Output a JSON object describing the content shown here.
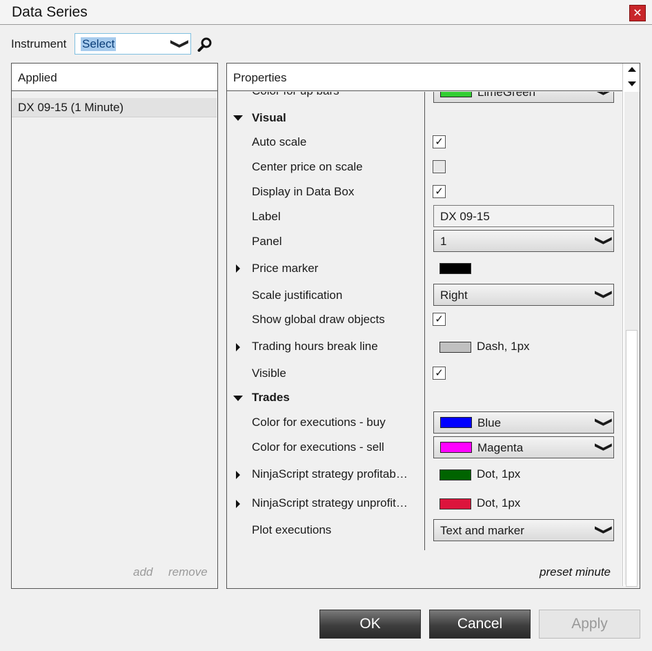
{
  "window": {
    "title": "Data Series",
    "close_symbol": "✕"
  },
  "instrument": {
    "label": "Instrument",
    "value": "Select",
    "chevron": "❯"
  },
  "applied": {
    "header": "Applied",
    "items": [
      "DX 09-15 (1 Minute)"
    ],
    "add": "add",
    "remove": "remove"
  },
  "properties": {
    "header": "Properties",
    "partial_row": {
      "name": "Color for up bars",
      "swatch": "#32cd32",
      "value": "LimeGreen"
    },
    "visual": {
      "category": "Visual",
      "auto_scale": "Auto scale",
      "center_price": "Center price on scale",
      "display_data_box": "Display in Data Box",
      "label": "Label",
      "label_value": "DX 09-15",
      "panel": "Panel",
      "panel_value": "1",
      "price_marker": "Price marker",
      "price_marker_color": "#000000",
      "scale_justification": "Scale justification",
      "scale_justification_value": "Right",
      "show_global": "Show global draw objects",
      "trading_hours": "Trading hours break line",
      "trading_hours_color": "#c0c0c0",
      "trading_hours_value": "Dash, 1px",
      "visible": "Visible"
    },
    "trades": {
      "category": "Trades",
      "exec_buy": "Color for executions - buy",
      "exec_buy_color": "#0000ff",
      "exec_buy_value": "Blue",
      "exec_sell": "Color for executions - sell",
      "exec_sell_color": "#ff00ff",
      "exec_sell_value": "Magenta",
      "profitable": "NinjaScript strategy profitab…",
      "profitable_color": "#006400",
      "profitable_value": "Dot, 1px",
      "unprofitable": "NinjaScript strategy unprofit…",
      "unprofitable_color": "#dc143c",
      "unprofitable_value": "Dot, 1px",
      "plot_exec": "Plot executions",
      "plot_exec_value": "Text and marker"
    },
    "checkmark": "✓",
    "dropdown_chevron": "❯",
    "footer": "preset minute"
  },
  "buttons": {
    "ok": "OK",
    "cancel": "Cancel",
    "apply": "Apply"
  }
}
